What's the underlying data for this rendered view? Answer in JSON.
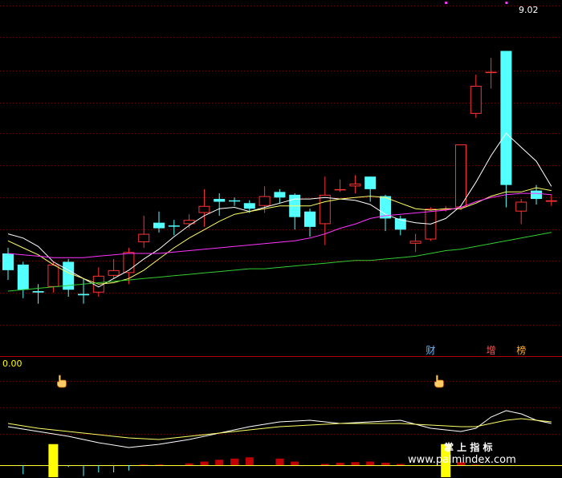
{
  "chart_data": [
    {
      "type": "candlestick",
      "panel": "main",
      "high_label": "9.02",
      "candles": [
        {
          "o": 7.24,
          "c": 7.12,
          "h": 7.28,
          "l": 7.05,
          "color": "cyan"
        },
        {
          "o": 7.16,
          "c": 6.98,
          "h": 7.18,
          "l": 6.92,
          "color": "cyan"
        },
        {
          "o": 6.97,
          "c": 6.96,
          "h": 7.02,
          "l": 6.88,
          "color": "cyan"
        },
        {
          "o": 7.0,
          "c": 7.16,
          "h": 7.18,
          "l": 6.96,
          "color": "red"
        },
        {
          "o": 7.18,
          "c": 6.98,
          "h": 7.2,
          "l": 6.93,
          "color": "cyan"
        },
        {
          "o": 6.95,
          "c": 6.94,
          "h": 7.06,
          "l": 6.88,
          "color": "cyan"
        },
        {
          "o": 6.96,
          "c": 7.08,
          "h": 7.14,
          "l": 6.93,
          "color": "red"
        },
        {
          "o": 7.08,
          "c": 7.12,
          "h": 7.2,
          "l": 7.06,
          "color": "red"
        },
        {
          "o": 7.1,
          "c": 7.25,
          "h": 7.28,
          "l": 7.02,
          "color": "red"
        },
        {
          "o": 7.32,
          "c": 7.38,
          "h": 7.51,
          "l": 7.28,
          "color": "red"
        },
        {
          "o": 7.46,
          "c": 7.42,
          "h": 7.54,
          "l": 7.39,
          "color": "cyan"
        },
        {
          "o": 7.44,
          "c": 7.44,
          "h": 7.48,
          "l": 7.37,
          "color": "cyan"
        },
        {
          "o": 7.45,
          "c": 7.48,
          "h": 7.52,
          "l": 7.42,
          "color": "red"
        },
        {
          "o": 7.53,
          "c": 7.58,
          "h": 7.7,
          "l": 7.43,
          "color": "red"
        },
        {
          "o": 7.61,
          "c": 7.63,
          "h": 7.67,
          "l": 7.51,
          "color": "cyan"
        },
        {
          "o": 7.62,
          "c": 7.62,
          "h": 7.64,
          "l": 7.58,
          "color": "cyan"
        },
        {
          "o": 7.6,
          "c": 7.56,
          "h": 7.62,
          "l": 7.53,
          "color": "cyan"
        },
        {
          "o": 7.58,
          "c": 7.65,
          "h": 7.72,
          "l": 7.53,
          "color": "red"
        },
        {
          "o": 7.68,
          "c": 7.64,
          "h": 7.7,
          "l": 7.6,
          "color": "cyan"
        },
        {
          "o": 7.66,
          "c": 7.5,
          "h": 7.67,
          "l": 7.41,
          "color": "cyan"
        },
        {
          "o": 7.54,
          "c": 7.43,
          "h": 7.56,
          "l": 7.36,
          "color": "cyan"
        },
        {
          "o": 7.45,
          "c": 7.66,
          "h": 7.79,
          "l": 7.3,
          "color": "red"
        },
        {
          "o": 7.7,
          "c": 7.7,
          "h": 7.77,
          "l": 7.68,
          "color": "red"
        },
        {
          "o": 7.72,
          "c": 7.74,
          "h": 7.8,
          "l": 7.67,
          "color": "red"
        },
        {
          "o": 7.79,
          "c": 7.7,
          "h": 7.79,
          "l": 7.61,
          "color": "cyan"
        },
        {
          "o": 7.65,
          "c": 7.49,
          "h": 7.66,
          "l": 7.4,
          "color": "cyan"
        },
        {
          "o": 7.49,
          "c": 7.41,
          "h": 7.51,
          "l": 7.37,
          "color": "cyan"
        },
        {
          "o": 7.31,
          "c": 7.33,
          "h": 7.38,
          "l": 7.25,
          "color": "red"
        },
        {
          "o": 7.34,
          "c": 7.56,
          "h": 7.57,
          "l": 7.33,
          "color": "red"
        },
        {
          "o": 7.56,
          "c": 7.56,
          "h": 7.58,
          "l": 7.54,
          "color": "red"
        },
        {
          "o": 7.57,
          "c": 8.02,
          "h": 8.02,
          "l": 7.55,
          "color": "red"
        },
        {
          "o": 8.24,
          "c": 8.44,
          "h": 8.52,
          "l": 8.21,
          "color": "red"
        },
        {
          "o": 8.54,
          "c": 8.54,
          "h": 8.64,
          "l": 8.42,
          "color": "red"
        },
        {
          "o": 8.69,
          "c": 7.73,
          "h": 8.69,
          "l": 7.57,
          "color": "cyan"
        },
        {
          "o": 7.61,
          "c": 7.54,
          "h": 7.63,
          "l": 7.45,
          "color": "red"
        },
        {
          "o": 7.69,
          "c": 7.63,
          "h": 7.73,
          "l": 7.59,
          "color": "cyan"
        },
        {
          "o": 7.61,
          "c": 7.62,
          "h": 7.66,
          "l": 7.58,
          "color": "red"
        }
      ],
      "ma_lines": [
        {
          "color": "#ffffff",
          "points": [
            [
              0,
              7.38
            ],
            [
              1,
              7.35
            ],
            [
              2,
              7.29
            ],
            [
              3,
              7.18
            ],
            [
              4,
              7.12
            ],
            [
              5,
              7.06
            ],
            [
              6,
              7.0
            ],
            [
              7,
              7.06
            ],
            [
              8,
              7.12
            ],
            [
              9,
              7.2
            ],
            [
              10,
              7.27
            ],
            [
              11,
              7.36
            ],
            [
              12,
              7.44
            ],
            [
              13,
              7.51
            ],
            [
              14,
              7.56
            ],
            [
              15,
              7.57
            ],
            [
              16,
              7.54
            ],
            [
              17,
              7.57
            ],
            [
              18,
              7.6
            ],
            [
              19,
              7.63
            ],
            [
              20,
              7.63
            ],
            [
              21,
              7.64
            ],
            [
              22,
              7.63
            ],
            [
              23,
              7.62
            ],
            [
              24,
              7.59
            ],
            [
              25,
              7.52
            ],
            [
              26,
              7.48
            ],
            [
              27,
              7.46
            ],
            [
              28,
              7.45
            ],
            [
              29,
              7.49
            ],
            [
              30,
              7.58
            ],
            [
              31,
              7.75
            ],
            [
              32,
              7.94
            ],
            [
              33,
              8.1
            ],
            [
              34,
              8.0
            ],
            [
              35,
              7.9
            ],
            [
              36,
              7.72
            ]
          ]
        },
        {
          "color": "#ffff66",
          "points": [
            [
              0,
              7.33
            ],
            [
              1,
              7.28
            ],
            [
              2,
              7.23
            ],
            [
              3,
              7.16
            ],
            [
              4,
              7.1
            ],
            [
              5,
              7.06
            ],
            [
              6,
              7.02
            ],
            [
              7,
              7.03
            ],
            [
              8,
              7.06
            ],
            [
              9,
              7.12
            ],
            [
              10,
              7.2
            ],
            [
              11,
              7.28
            ],
            [
              12,
              7.35
            ],
            [
              13,
              7.41
            ],
            [
              14,
              7.47
            ],
            [
              15,
              7.52
            ],
            [
              16,
              7.54
            ],
            [
              17,
              7.56
            ],
            [
              18,
              7.58
            ],
            [
              19,
              7.58
            ],
            [
              20,
              7.58
            ],
            [
              21,
              7.61
            ],
            [
              22,
              7.63
            ],
            [
              23,
              7.64
            ],
            [
              24,
              7.65
            ],
            [
              25,
              7.64
            ],
            [
              26,
              7.6
            ],
            [
              27,
              7.56
            ],
            [
              28,
              7.55
            ],
            [
              29,
              7.56
            ],
            [
              30,
              7.56
            ],
            [
              31,
              7.6
            ],
            [
              32,
              7.65
            ],
            [
              33,
              7.68
            ],
            [
              34,
              7.68
            ],
            [
              35,
              7.71
            ],
            [
              36,
              7.69
            ]
          ]
        },
        {
          "color": "#ff33ff",
          "points": [
            [
              0,
              7.24
            ],
            [
              1,
              7.23
            ],
            [
              2,
              7.22
            ],
            [
              3,
              7.21
            ],
            [
              4,
              7.21
            ],
            [
              5,
              7.21
            ],
            [
              6,
              7.22
            ],
            [
              7,
              7.23
            ],
            [
              8,
              7.24
            ],
            [
              9,
              7.24
            ],
            [
              10,
              7.24
            ],
            [
              11,
              7.25
            ],
            [
              12,
              7.26
            ],
            [
              13,
              7.27
            ],
            [
              14,
              7.28
            ],
            [
              15,
              7.29
            ],
            [
              16,
              7.3
            ],
            [
              17,
              7.31
            ],
            [
              18,
              7.32
            ],
            [
              19,
              7.33
            ],
            [
              20,
              7.35
            ],
            [
              21,
              7.38
            ],
            [
              22,
              7.42
            ],
            [
              23,
              7.45
            ],
            [
              24,
              7.49
            ],
            [
              25,
              7.51
            ],
            [
              26,
              7.52
            ],
            [
              27,
              7.53
            ],
            [
              28,
              7.54
            ],
            [
              29,
              7.55
            ],
            [
              30,
              7.57
            ],
            [
              31,
              7.61
            ],
            [
              32,
              7.64
            ],
            [
              33,
              7.66
            ],
            [
              34,
              7.67
            ],
            [
              35,
              7.67
            ],
            [
              36,
              7.66
            ]
          ]
        },
        {
          "color": "#33cc33",
          "points": [
            [
              0,
              6.97
            ],
            [
              1,
              6.98
            ],
            [
              2,
              6.99
            ],
            [
              3,
              7.0
            ],
            [
              4,
              7.01
            ],
            [
              5,
              7.02
            ],
            [
              6,
              7.03
            ],
            [
              7,
              7.04
            ],
            [
              8,
              7.05
            ],
            [
              9,
              7.06
            ],
            [
              10,
              7.07
            ],
            [
              11,
              7.08
            ],
            [
              12,
              7.09
            ],
            [
              13,
              7.1
            ],
            [
              14,
              7.11
            ],
            [
              15,
              7.12
            ],
            [
              16,
              7.13
            ],
            [
              17,
              7.13
            ],
            [
              18,
              7.14
            ],
            [
              19,
              7.15
            ],
            [
              20,
              7.16
            ],
            [
              21,
              7.17
            ],
            [
              22,
              7.18
            ],
            [
              23,
              7.19
            ],
            [
              24,
              7.19
            ],
            [
              25,
              7.2
            ],
            [
              26,
              7.21
            ],
            [
              27,
              7.22
            ],
            [
              28,
              7.24
            ],
            [
              29,
              7.26
            ],
            [
              30,
              7.27
            ],
            [
              31,
              7.29
            ],
            [
              32,
              7.31
            ],
            [
              33,
              7.33
            ],
            [
              34,
              7.35
            ],
            [
              35,
              7.37
            ],
            [
              36,
              7.39
            ]
          ]
        }
      ],
      "signal_labels": [
        {
          "i": 28,
          "text": "财",
          "color": "#66bbff"
        },
        {
          "i": 32,
          "text": "增",
          "color": "#ff5555"
        },
        {
          "i": 34,
          "text": "榜",
          "color": "#ffaa33"
        }
      ],
      "top_markers": [
        {
          "i": 29
        },
        {
          "i": 33
        }
      ]
    },
    {
      "type": "indicator",
      "panel": "lower",
      "value_label": "0.00",
      "line_white": [
        [
          0,
          -0.02
        ],
        [
          2,
          -0.05
        ],
        [
          4,
          -0.08
        ],
        [
          6,
          -0.12
        ],
        [
          8,
          -0.15
        ],
        [
          10,
          -0.13
        ],
        [
          12,
          -0.1
        ],
        [
          14,
          -0.06
        ],
        [
          16,
          -0.02
        ],
        [
          18,
          0.01
        ],
        [
          20,
          0.02
        ],
        [
          22,
          0.0
        ],
        [
          24,
          0.01
        ],
        [
          26,
          0.02
        ],
        [
          28,
          -0.03
        ],
        [
          30,
          -0.05
        ],
        [
          31,
          -0.03
        ],
        [
          32,
          0.04
        ],
        [
          33,
          0.08
        ],
        [
          34,
          0.06
        ],
        [
          35,
          0.02
        ],
        [
          36,
          0.0
        ]
      ],
      "line_yellow": [
        [
          0,
          0.0
        ],
        [
          2,
          -0.03
        ],
        [
          4,
          -0.05
        ],
        [
          6,
          -0.07
        ],
        [
          8,
          -0.09
        ],
        [
          10,
          -0.1
        ],
        [
          12,
          -0.08
        ],
        [
          14,
          -0.06
        ],
        [
          16,
          -0.04
        ],
        [
          18,
          -0.02
        ],
        [
          20,
          -0.01
        ],
        [
          22,
          0.0
        ],
        [
          24,
          0.0
        ],
        [
          26,
          0.0
        ],
        [
          28,
          -0.01
        ],
        [
          30,
          -0.02
        ],
        [
          31,
          -0.02
        ],
        [
          32,
          0.0
        ],
        [
          33,
          0.02
        ],
        [
          34,
          0.03
        ],
        [
          35,
          0.02
        ],
        [
          36,
          0.01
        ]
      ],
      "bars": [
        0,
        0.05,
        0,
        0.35,
        0.01,
        0.06,
        0.04,
        0.04,
        0.03,
        0.01,
        0.01,
        0,
        0.03,
        0.06,
        0.09,
        0.11,
        0.13,
        0,
        0.11,
        0.06,
        0,
        0.02,
        0.04,
        0.05,
        0.06,
        0.04,
        0.02,
        0,
        0,
        0.35,
        0.05,
        0.01,
        0,
        0,
        0,
        0,
        0
      ],
      "bar_colors": [
        "none",
        "cyan",
        "none",
        "yellow",
        "cyan",
        "cyan",
        "cyan",
        "cyan",
        "cyan",
        "red",
        "red",
        "none",
        "red",
        "red",
        "red",
        "red",
        "red",
        "none",
        "red",
        "red",
        "none",
        "red",
        "red",
        "red",
        "red",
        "red",
        "red",
        "none",
        "none",
        "yellow",
        "red",
        "red",
        "none",
        "none",
        "none",
        "none",
        "none"
      ],
      "pointer_icons": [
        {
          "i": 3
        },
        {
          "i": 28
        }
      ]
    }
  ],
  "watermark": {
    "title": "掌 上 指 标",
    "url": "www.palmindex.com"
  },
  "colors": {
    "up": "#ff3333",
    "down": "#54ffff",
    "grid": "#7a0000",
    "background": "#000000"
  }
}
